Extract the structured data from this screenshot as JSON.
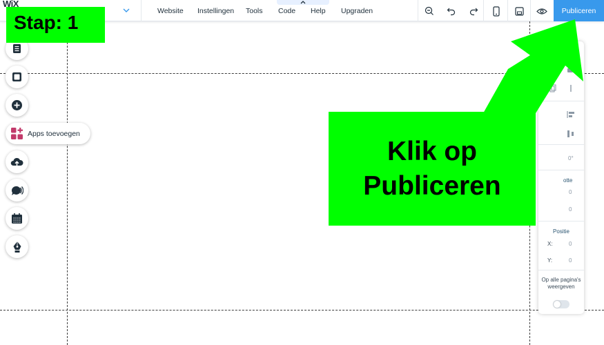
{
  "app": {
    "logo_text": "WiX"
  },
  "topbar": {
    "menu": [
      "Website",
      "Instellingen",
      "Tools",
      "Code",
      "Help",
      "Upgraden"
    ],
    "publish_label": "Publiceren",
    "tools": [
      "zoom-out-icon",
      "undo-icon",
      "redo-icon",
      "mobile-view-icon",
      "save-icon",
      "preview-icon"
    ]
  },
  "rail": {
    "apps_label": "Apps toevoegen",
    "icons": [
      "pages-icon",
      "background-icon",
      "add-icon",
      "apps-icon",
      "upload-icon",
      "chat-icon",
      "calendar-icon",
      "pen-icon"
    ]
  },
  "panel": {
    "rotation": "0°",
    "size_heading_partial": "otte",
    "size_w": "0",
    "size_h": "0",
    "position_heading": "Positie",
    "x_label": "X:",
    "x_value": "0",
    "y_label": "Y:",
    "y_value": "0",
    "show_all_pages": "Op alle pagina's weergeven"
  },
  "annotations": {
    "step": "Stap: 1",
    "instruction_line1": "Klik op",
    "instruction_line2": "Publiceren",
    "highlight_color": "#00ff00"
  },
  "colors": {
    "accent": "#3899ec",
    "text": "#20303c"
  }
}
